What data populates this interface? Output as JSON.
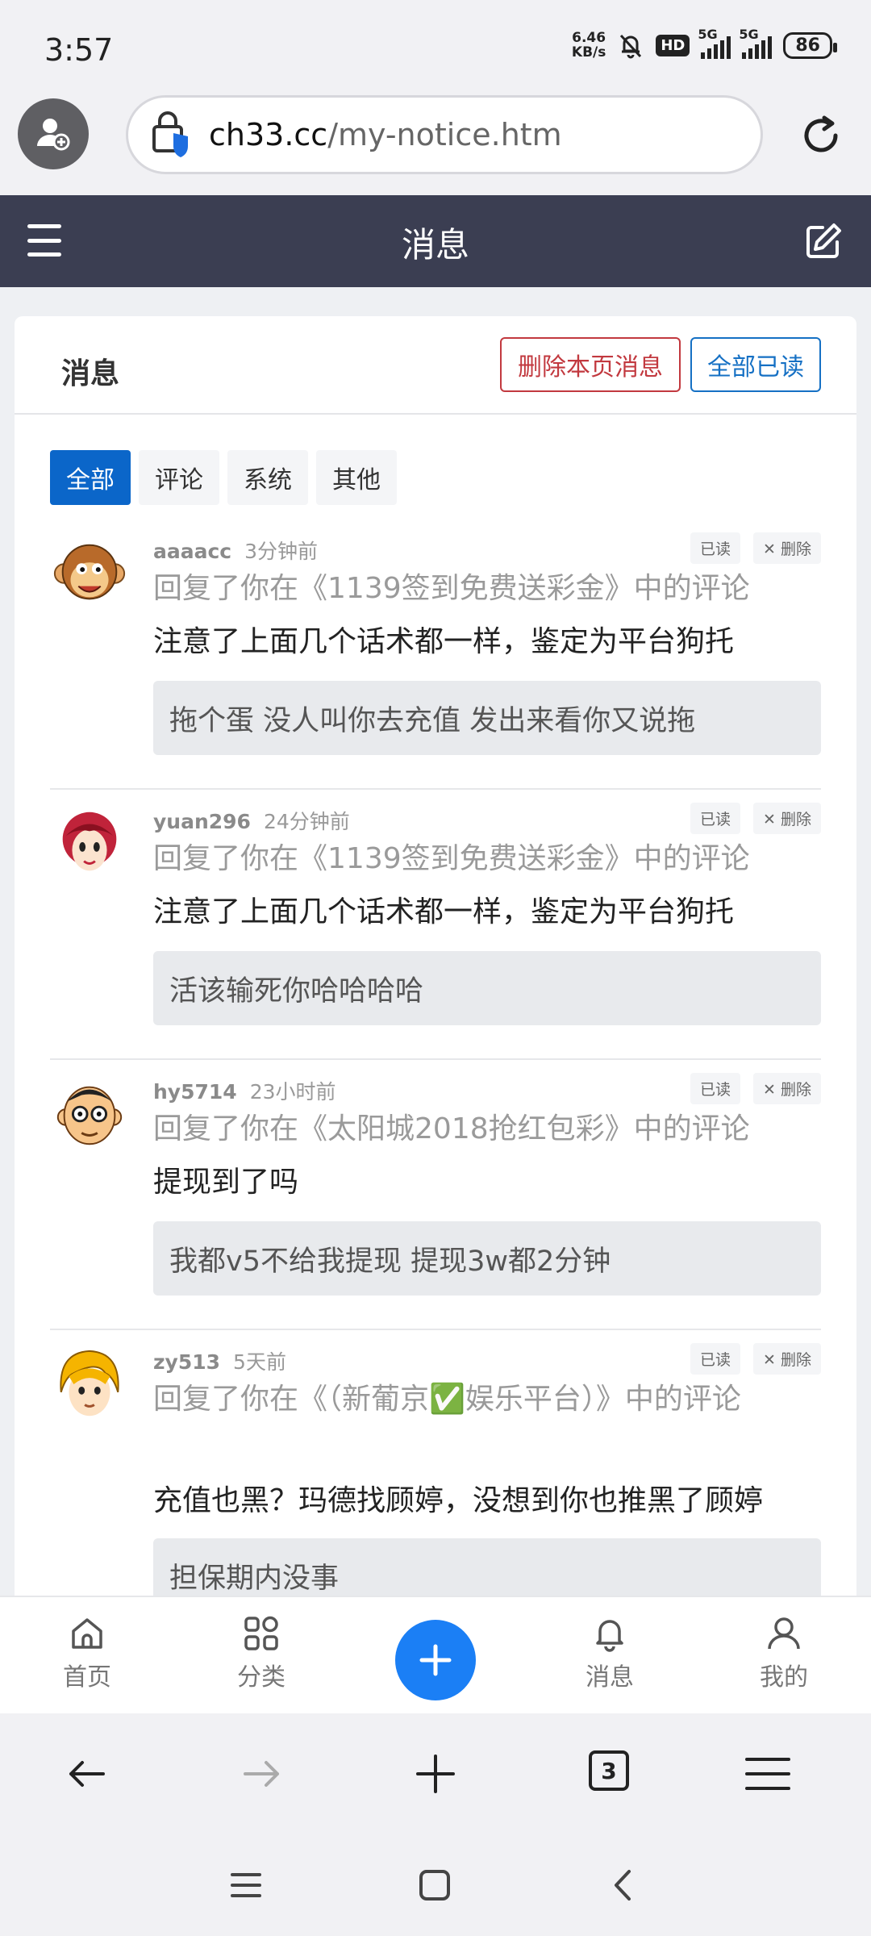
{
  "status_bar": {
    "time": "3:57",
    "net_speed_value": "6.46",
    "net_speed_unit": "KB/s",
    "hd_label": "HD",
    "sim1_label": "5G",
    "sim2_label": "5G",
    "battery": "86"
  },
  "browser": {
    "url_host": "ch33.cc",
    "url_path": "/my-notice.htm",
    "tab_count": "3"
  },
  "header": {
    "title": "消息"
  },
  "card": {
    "title": "消息",
    "delete_page_label": "删除本页消息",
    "mark_all_read_label": "全部已读"
  },
  "tabs": [
    {
      "label": "全部",
      "active": true
    },
    {
      "label": "评论",
      "active": false
    },
    {
      "label": "系统",
      "active": false
    },
    {
      "label": "其他",
      "active": false
    }
  ],
  "notices": [
    {
      "user": "aaaacc",
      "time": "3分钟前",
      "read_label": "已读",
      "delete_label": "删除",
      "reply_prefix": "回复了你在",
      "article": "《1139签到免费送彩金》",
      "reply_suffix": "中的评论",
      "comment": "注意了上面几个话术都一样，鉴定为平台狗托",
      "quote": "拖个蛋 没人叫你去充值 发出来看你又说拖"
    },
    {
      "user": "yuan296",
      "time": "24分钟前",
      "read_label": "已读",
      "delete_label": "删除",
      "reply_prefix": "回复了你在",
      "article": "《1139签到免费送彩金》",
      "reply_suffix": "中的评论",
      "comment": "注意了上面几个话术都一样，鉴定为平台狗托",
      "quote": "活该输死你哈哈哈哈"
    },
    {
      "user": "hy5714",
      "time": "23小时前",
      "read_label": "已读",
      "delete_label": "删除",
      "reply_prefix": "回复了你在",
      "article": "《太阳城2018抢红包彩》",
      "reply_suffix": "中的评论",
      "comment": "提现到了吗",
      "quote": "我都v5不给我提现 提现3w都2分钟"
    },
    {
      "user": "zy513",
      "time": "5天前",
      "read_label": "已读",
      "delete_label": "删除",
      "reply_prefix": "回复了你在",
      "article": "《（新葡京✅娱乐平台）》",
      "reply_suffix": "中的评论",
      "comment": "充值也黑？玛德找顾婷，没想到你也推黑了顾婷",
      "quote": "担保期内没事"
    }
  ],
  "app_nav": {
    "home": "首页",
    "category": "分类",
    "messages": "消息",
    "mine": "我的"
  },
  "colors": {
    "header_bg": "#3b3e52",
    "accent_blue": "#0b66c9",
    "danger_red": "#c2393f",
    "fab_blue": "#1b7ff5"
  }
}
